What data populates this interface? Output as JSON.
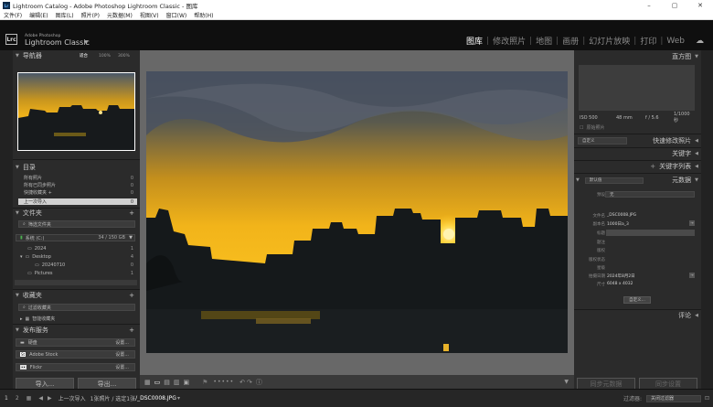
{
  "window": {
    "title": "Lightroom Catalog - Adobe Photoshop Lightroom Classic - 图库",
    "controls": [
      "–",
      "▢",
      "✕"
    ]
  },
  "menu": [
    "文件(F)",
    "编辑(E)",
    "图库(L)",
    "照片(P)",
    "元数据(M)",
    "视图(V)",
    "窗口(W)",
    "帮助(H)"
  ],
  "brand": {
    "line1": "Adobe Photoshop",
    "line2": "Lightroom Classic",
    "logo": "Lrc"
  },
  "modules": [
    "图库",
    "修改照片",
    "地图",
    "画册",
    "幻灯片放映",
    "打印",
    "Web"
  ],
  "navigator": {
    "title": "导航器",
    "zoom": [
      "适合",
      "100%",
      "300%"
    ]
  },
  "catalog": {
    "title": "目录",
    "items": [
      {
        "label": "所有照片",
        "count": "0"
      },
      {
        "label": "所有已同步照片",
        "count": "0"
      },
      {
        "label": "快捷收藏夹 +",
        "count": "0"
      },
      {
        "label": "上一次导入",
        "count": "0"
      }
    ]
  },
  "folders": {
    "title": "文件夹",
    "filter": "筛选文件夹",
    "drive": {
      "label": "系统 (C:)",
      "space": "34 / 150 GB"
    },
    "items": [
      {
        "label": "2024",
        "count": "1"
      },
      {
        "label": "Desktop",
        "count": "4"
      },
      {
        "label": "20240710",
        "count": "0"
      },
      {
        "label": "Pictures",
        "count": "1"
      }
    ]
  },
  "collections": {
    "title": "收藏夹",
    "items": [
      "过滤收藏夹",
      "智能收藏夹"
    ]
  },
  "publish": {
    "title": "发布服务",
    "items": [
      {
        "label": "硬盘",
        "action": "设置..."
      },
      {
        "label": "Adobe Stock",
        "action": "设置..."
      },
      {
        "label": "Flickr",
        "action": "设置..."
      }
    ]
  },
  "buttons": {
    "import": "导入...",
    "export": "导出..."
  },
  "right": {
    "histogram": "直方图",
    "exif": [
      "ISO 500",
      "48 mm",
      "f / 5.6",
      "1/1000 秒"
    ],
    "original": "原始照片",
    "quick_develop": "快速修改照片",
    "saved_preset": "自定义",
    "keywords": "关键字",
    "keyword_list": "关键字列表",
    "metadata": "元数据",
    "preset_label": "默认值",
    "preset_field": "预设",
    "preset_value": "无",
    "fields": [
      {
        "label": "文件名",
        "value": "_DSC0008.JPG"
      },
      {
        "label": "副本名",
        "value": "1000日a_3"
      },
      {
        "label": "标题",
        "value": ""
      },
      {
        "label": "题注",
        "value": ""
      },
      {
        "label": "版权",
        "value": ""
      },
      {
        "label": "版权状态",
        "value": ""
      },
      {
        "label": "星级",
        "value": ""
      },
      {
        "label": "拍摄日期",
        "value": "2024年8月2日"
      },
      {
        "label": "尺寸",
        "value": "6048 x 4032"
      }
    ],
    "custom_btn": "自定义...",
    "comments": "评论",
    "sync_meta": "同步元数据",
    "sync_settings": "同步设置"
  },
  "filmstrip": {
    "source": "上一次导入",
    "count": "1张照片 / 选定1张",
    "file": "/_DSC0008.JPG",
    "filter_label": "过滤器:",
    "filter_value": "关闭过滤器"
  },
  "colors": {
    "accent": "#ffffff",
    "panel": "#2b2b2b",
    "bg": "#1c1c1c"
  }
}
